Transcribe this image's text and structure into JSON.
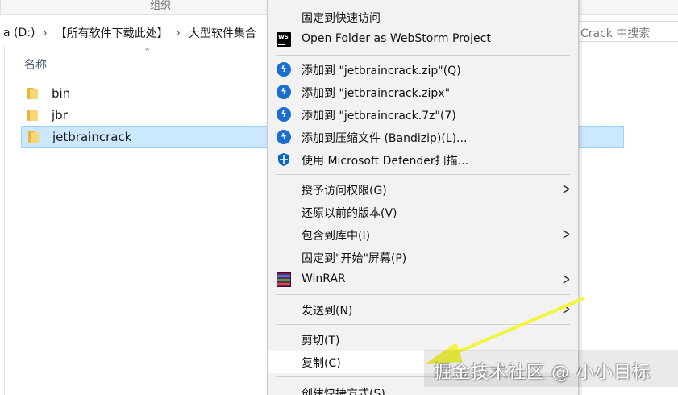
{
  "ribbon": {
    "group_label": "组织"
  },
  "address": {
    "crumbs": [
      "a (D:)",
      "【所有软件下载此处】",
      "大型软件集合"
    ],
    "search_placeholder": "Crack 中搜索"
  },
  "file_list": {
    "column_name": "名称",
    "items": [
      {
        "name": "bin",
        "selected": false
      },
      {
        "name": "jbr",
        "selected": false
      },
      {
        "name": "jetbraincrack",
        "selected": true
      }
    ]
  },
  "context_menu": {
    "items": [
      {
        "label": "固定到快速访问",
        "icon": "none"
      },
      {
        "label": "Open Folder as WebStorm Project",
        "icon": "webstorm-icon"
      },
      {
        "label": "添加到 \"jetbraincrack.zip\"(Q)",
        "icon": "bandizip-icon"
      },
      {
        "label": "添加到 \"jetbraincrack.zipx\"",
        "icon": "bandizip-icon"
      },
      {
        "label": "添加到 \"jetbraincrack.7z\"(7)",
        "icon": "bandizip-icon"
      },
      {
        "label": "添加到压缩文件 (Bandizip)(L)...",
        "icon": "bandizip-icon"
      },
      {
        "label": "使用 Microsoft Defender扫描...",
        "icon": "shield-icon"
      },
      {
        "label": "授予访问权限(G)",
        "icon": "none",
        "submenu": true
      },
      {
        "label": "还原以前的版本(V)",
        "icon": "none"
      },
      {
        "label": "包含到库中(I)",
        "icon": "none",
        "submenu": true
      },
      {
        "label": "固定到\"开始\"屏幕(P)",
        "icon": "none"
      },
      {
        "label": "WinRAR",
        "icon": "winrar-icon",
        "submenu": true
      },
      {
        "label": "发送到(N)",
        "icon": "none",
        "submenu": true
      },
      {
        "label": "剪切(T)",
        "icon": "none"
      },
      {
        "label": "复制(C)",
        "icon": "none",
        "highlighted": true
      },
      {
        "label": "创建快捷方式(S)",
        "icon": "none"
      }
    ]
  },
  "watermark": {
    "text": "掘金技术社区 @ 小小目标"
  },
  "colors": {
    "selection_bg": "#cce8ff",
    "menu_bg": "#f2f2f2",
    "arrow": "#f2f53a",
    "bandizip_blue": "#1c6fd1",
    "folder_yellow": "#f8d775"
  }
}
